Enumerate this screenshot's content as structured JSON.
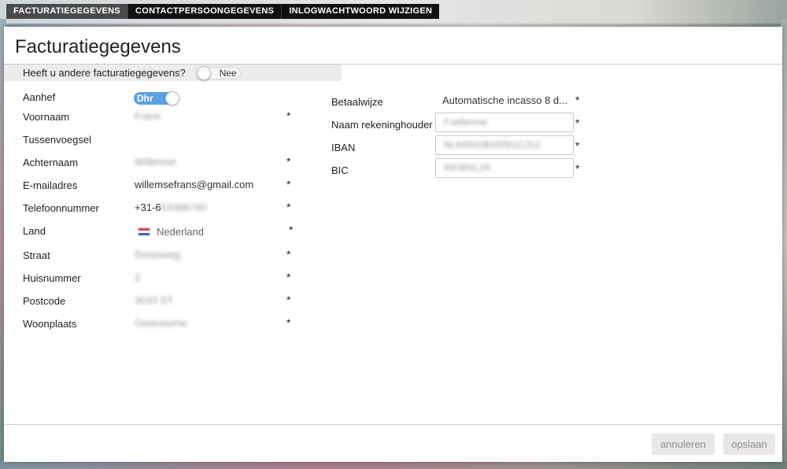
{
  "tabs": [
    {
      "label": "FACTURATIEGEGEVENS",
      "active": true
    },
    {
      "label": "CONTACTPERSOONGEGEVENS",
      "active": false
    },
    {
      "label": "INLOGWACHTWOORD WIJZIGEN",
      "active": false
    }
  ],
  "title": "Facturatiegegevens",
  "alt_billing": {
    "question": "Heeft u andere facturatiegegevens?",
    "toggle_label": "Nee",
    "enabled": false
  },
  "left_fields": {
    "aanhef": {
      "label": "Aanhef",
      "value": "Dhr"
    },
    "voornaam": {
      "label": "Voornaam",
      "value": "Frans",
      "required": "*"
    },
    "tussenvoegsel": {
      "label": "Tussenvoegsel",
      "value": ""
    },
    "achternaam": {
      "label": "Achternaam",
      "value": "Willemse",
      "required": "*"
    },
    "email": {
      "label": "E-mailadres",
      "value": "willemsefrans@gmail.com",
      "required": "*"
    },
    "telefoon": {
      "label": "Telefoonnummer",
      "value_visible": "+31-6",
      "value_hidden": "53396760",
      "required": "*"
    },
    "land": {
      "label": "Land",
      "value": "Nederland",
      "required": "*"
    },
    "straat": {
      "label": "Straat",
      "value": "Dorpsweg",
      "required": "*"
    },
    "huisnummer": {
      "label": "Huisnummer",
      "value": "2",
      "required": "*"
    },
    "postcode": {
      "label": "Postcode",
      "value": "3033 ST",
      "required": "*"
    },
    "woonplaats": {
      "label": "Woonplaats",
      "value": "Oostvoorne",
      "required": "*"
    }
  },
  "right_fields": {
    "betaalwijze": {
      "label": "Betaalwijze",
      "value": "Automatische incasso 8 d...",
      "required": "*"
    },
    "rekeninghouder": {
      "label": "Naam rekeninghouder",
      "value": "F.willemse",
      "required": "*"
    },
    "iban": {
      "label": "IBAN",
      "value": "NL64INGB0009111312",
      "required": "*"
    },
    "bic": {
      "label": "BIC",
      "value": "INGBNL2A",
      "required": "*"
    }
  },
  "buttons": {
    "cancel": "annuleren",
    "save": "opslaan"
  },
  "colors": {
    "toggle_on": "#5aa0e6",
    "tab_bar": "#111111",
    "tab_active": "#4a4a4a"
  }
}
